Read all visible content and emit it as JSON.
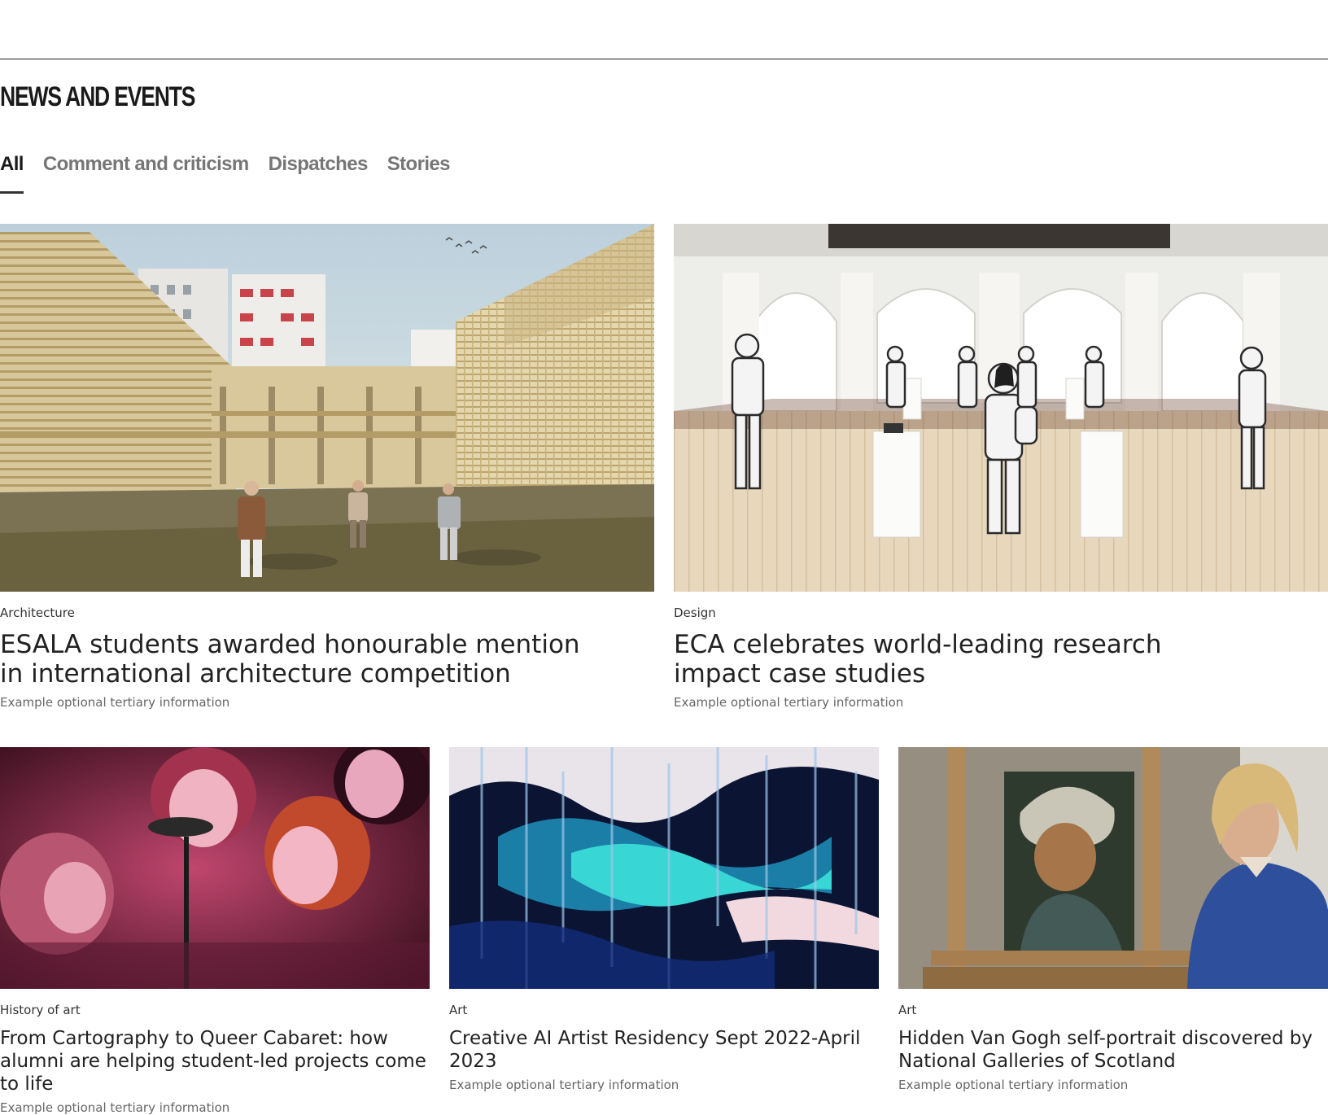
{
  "section": {
    "title": "NEWS AND EVENTS"
  },
  "tabs": [
    {
      "label": "All",
      "active": true
    },
    {
      "label": "Comment and criticism",
      "active": false
    },
    {
      "label": "Dispatches",
      "active": false
    },
    {
      "label": "Stories",
      "active": false
    }
  ],
  "cards": [
    {
      "category": "Architecture",
      "title": "ESALA students awarded honourable mention in international architecture competition",
      "meta": "Example optional tertiary information"
    },
    {
      "category": "Design",
      "title": "ECA celebrates world-leading research impact case studies",
      "meta": "Example optional tertiary information"
    },
    {
      "category": "History of art",
      "title": "From Cartography to Queer Cabaret: how alumni are helping student-led projects come to life",
      "meta": "Example optional tertiary information"
    },
    {
      "category": "Art",
      "title": "Creative AI Artist Residency Sept 2022-April 2023",
      "meta": "Example optional tertiary information"
    },
    {
      "category": "Art",
      "title": "Hidden Van Gogh self-portrait discovered by National Galleries of Scotland",
      "meta": "Example optional tertiary information"
    }
  ]
}
